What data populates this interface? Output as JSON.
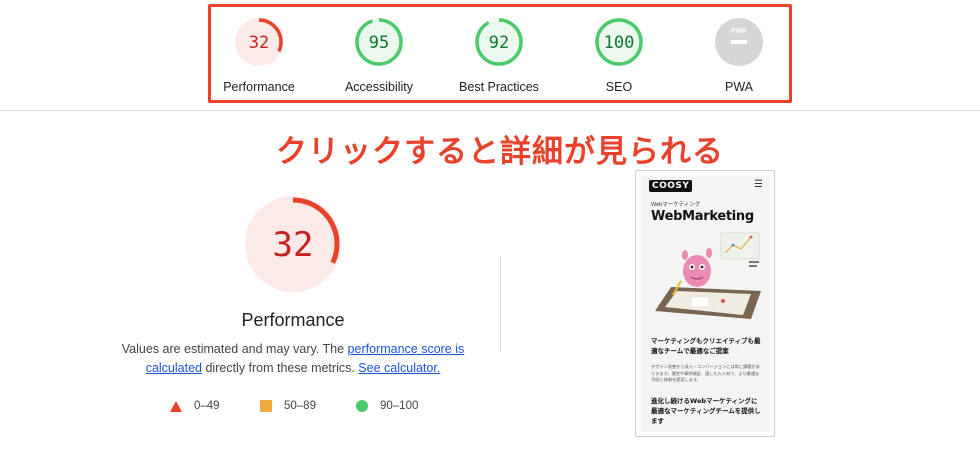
{
  "summary": {
    "gauges": [
      {
        "score": "32",
        "label": "Performance",
        "fraction": 0.32,
        "color": "#e8412c",
        "bg": "#fceae8",
        "text_color": "#c5221f"
      },
      {
        "score": "95",
        "label": "Accessibility",
        "fraction": 0.95,
        "color": "#4cc96b",
        "bg": "#ebf8ee",
        "text_color": "#0c7a2e"
      },
      {
        "score": "92",
        "label": "Best Practices",
        "fraction": 0.92,
        "color": "#4cc96b",
        "bg": "#ebf8ee",
        "text_color": "#0c7a2e"
      },
      {
        "score": "100",
        "label": "SEO",
        "fraction": 1.0,
        "color": "#4cc96b",
        "bg": "#ebf8ee",
        "text_color": "#0c7a2e"
      },
      {
        "score": "",
        "label": "PWA",
        "badge_text": "PWA",
        "color": "#d6d6d6",
        "bg": "#d6d6d6"
      }
    ]
  },
  "annotation": "クリックすると詳細が見られる",
  "performance": {
    "score": "32",
    "fraction": 0.32,
    "title": "Performance",
    "desc_prefix": "Values are estimated and may vary. The ",
    "link_score": "performance score is calculated",
    "desc_mid": " directly from these metrics. ",
    "link_calc": "See calculator.",
    "legend": [
      {
        "range": "0–49",
        "shape": "triangle",
        "color": "#e8412c"
      },
      {
        "range": "50–89",
        "shape": "square",
        "color": "#f0a93e"
      },
      {
        "range": "90–100",
        "shape": "circle",
        "color": "#4cc96b"
      }
    ]
  },
  "preview": {
    "logo": "COOSY",
    "menu_icon": "☰",
    "small_title": "Webマーケティング",
    "big_title": "WebMarketing",
    "heading1": "マーケティングもクリエイティブも最適なチームで最適なご提案",
    "body": "デザイン改善から流入・コンバージョンには常に課題がありきます。運営や事例検証、適したた人材で、より最適な手段と体制を提案します。",
    "heading2": "進化し続けるWebマーケティングに最適なマーケティングチームを提供します"
  },
  "colors": {
    "accent_red": "#e8412c",
    "link_blue": "#1a55d6",
    "pass_green": "#4cc96b",
    "average_orange": "#f0a93e"
  }
}
